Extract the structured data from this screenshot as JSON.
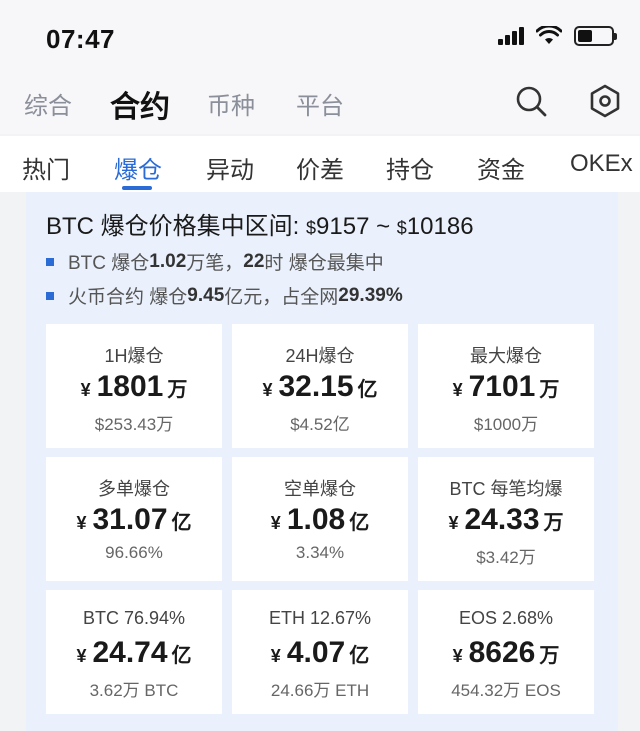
{
  "status_bar": {
    "time": "07:47",
    "icons": [
      "signal-icon",
      "wifi-icon",
      "battery-icon"
    ]
  },
  "top_nav": {
    "tabs": [
      {
        "label": "综合",
        "active": false
      },
      {
        "label": "合约",
        "active": true
      },
      {
        "label": "币种",
        "active": false
      },
      {
        "label": "平台",
        "active": false
      }
    ],
    "icons": [
      "search-icon",
      "settings-icon"
    ]
  },
  "sub_nav": {
    "tabs": [
      {
        "label": "热门",
        "active": false
      },
      {
        "label": "爆仓",
        "active": true
      },
      {
        "label": "异动",
        "active": false
      },
      {
        "label": "价差",
        "active": false
      },
      {
        "label": "持仓",
        "active": false
      },
      {
        "label": "资金",
        "active": false
      },
      {
        "label": "OKEx",
        "active": false
      }
    ]
  },
  "summary": {
    "title": "BTC 爆仓价格集中区间:",
    "currency": "$",
    "range_low": "9157",
    "range_sep": "~",
    "range_high": "10186",
    "bullets": [
      {
        "prefix": "BTC 爆仓 ",
        "value1": "1.02",
        "mid": " 万笔，",
        "value2": "22",
        "suffix": "时 爆仓最集中"
      },
      {
        "prefix": "火币合约 爆仓 ",
        "value1": "9.45",
        "mid": " 亿元，占全网 ",
        "value2": "29.39%",
        "suffix": ""
      }
    ]
  },
  "cards": [
    {
      "label": "1H爆仓",
      "currency": "¥",
      "value": "1801",
      "unit": "万",
      "sub": "$253.43万"
    },
    {
      "label": "24H爆仓",
      "currency": "¥",
      "value": "32.15",
      "unit": "亿",
      "sub": "$4.52亿"
    },
    {
      "label": "最大爆仓",
      "currency": "¥",
      "value": "7101",
      "unit": "万",
      "sub": "$1000万"
    },
    {
      "label": "多单爆仓",
      "currency": "¥",
      "value": "31.07",
      "unit": "亿",
      "sub": "96.66%"
    },
    {
      "label": "空单爆仓",
      "currency": "¥",
      "value": "1.08",
      "unit": "亿",
      "sub": "3.34%"
    },
    {
      "label": "BTC 每笔均爆",
      "currency": "¥",
      "value": "24.33",
      "unit": "万",
      "sub": "$3.42万"
    },
    {
      "label": "BTC 76.94%",
      "currency": "¥",
      "value": "24.74",
      "unit": "亿",
      "sub": "3.62万 BTC"
    },
    {
      "label": "ETH 12.67%",
      "currency": "¥",
      "value": "4.07",
      "unit": "亿",
      "sub": "24.66万 ETH"
    },
    {
      "label": "EOS 2.68%",
      "currency": "¥",
      "value": "8626",
      "unit": "万",
      "sub": "454.32万 EOS"
    }
  ],
  "colors": {
    "accent": "#2a6bd6",
    "panel_bg": "#eaf1fc",
    "card_bg": "#ffffff"
  }
}
